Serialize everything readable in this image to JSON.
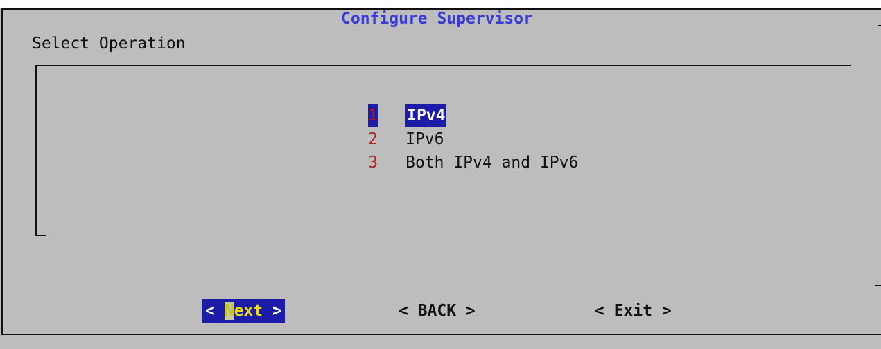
{
  "dialog": {
    "title": "Configure Supervisor",
    "subtitle": "Select Operation"
  },
  "menu": {
    "items": [
      {
        "number": "1",
        "label": "IPv4",
        "selected": true
      },
      {
        "number": "2",
        "label": "IPv6",
        "selected": false
      },
      {
        "number": "3",
        "label": "Both IPv4 and IPv6",
        "selected": false
      }
    ]
  },
  "buttons": {
    "next": {
      "open": "< ",
      "hotkey": "N",
      "rest": "ext",
      "close": " >"
    },
    "back_label": "< BACK >",
    "exit_label": "< Exit >"
  },
  "colors": {
    "background": "#bdbdbd",
    "title": "#3b3bd9",
    "highlight": "#1c1ca8",
    "menu_number": "#b22222",
    "active_button_text": "#e8e000"
  }
}
